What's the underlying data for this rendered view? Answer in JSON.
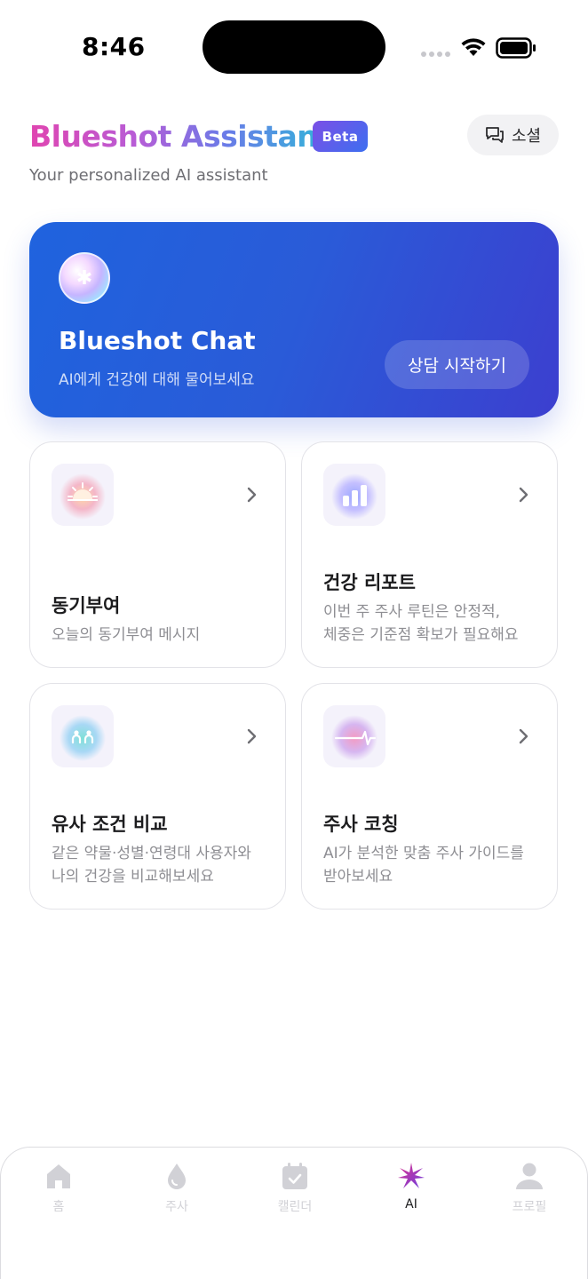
{
  "status_bar": {
    "time": "8:46"
  },
  "header": {
    "title": "Blueshot Assistant",
    "badge": "Beta",
    "social_label": "소셜",
    "subtitle": "Your personalized AI assistant"
  },
  "hero": {
    "title": "Blueshot Chat",
    "description": "AI에게 건강에 대해 물어보세요",
    "button_label": "상담 시작하기"
  },
  "cards": [
    {
      "title": "동기부여",
      "description": "오늘의 동기부여 메시지",
      "icon": "sunrise-icon"
    },
    {
      "title": "건강 리포트",
      "description": "이번 주 주사 루틴은 안정적, 체중은 기준점 확보가 필요해요",
      "icon": "bar-chart-icon"
    },
    {
      "title": "유사 조건 비교",
      "description": "같은 약물·성별·연령대 사용자와 나의 건강을 비교해보세요",
      "icon": "people-compare-icon"
    },
    {
      "title": "주사 코칭",
      "description": "AI가 분석한 맞춤 주사 가이드를 받아보세요",
      "icon": "pulse-line-icon"
    }
  ],
  "tabs": [
    {
      "label": "홈",
      "icon": "home-icon",
      "active": false
    },
    {
      "label": "주사",
      "icon": "drop-icon",
      "active": false
    },
    {
      "label": "캘린더",
      "icon": "calendar-icon",
      "active": false
    },
    {
      "label": "AI",
      "icon": "sparkle-icon",
      "active": true
    },
    {
      "label": "프로필",
      "icon": "person-icon",
      "active": false
    }
  ],
  "colors": {
    "hero_start": "#1f63de",
    "hero_end": "#3c3fcf",
    "accent_purple": "#7b4fe6",
    "inactive_tab": "#d1d1d6"
  }
}
